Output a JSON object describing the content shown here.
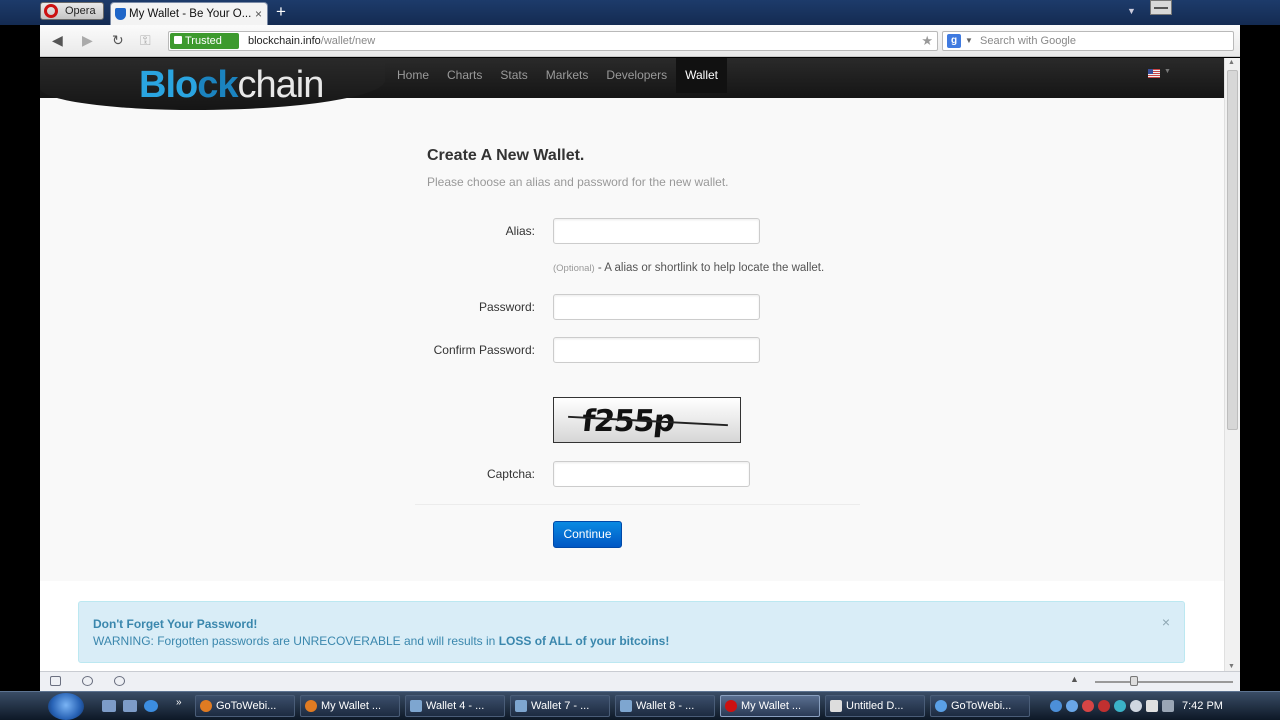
{
  "browser": {
    "opera_label": "Opera",
    "tab_title": "My Wallet - Be Your O...",
    "trusted_label": "Trusted",
    "url_host": "blockchain.info",
    "url_path": "/wallet/new",
    "search_placeholder": "Search with Google"
  },
  "site": {
    "logo_b": "Blo",
    "logo_c": "ck",
    "logo_rest": "chain",
    "nav": [
      "Home",
      "Charts",
      "Stats",
      "Markets",
      "Developers",
      "Wallet"
    ],
    "active_nav": "Wallet"
  },
  "form": {
    "title": "Create A New Wallet.",
    "subtitle": "Please choose an alias and password for the new wallet.",
    "alias_label": "Alias:",
    "alias_value": "",
    "alias_help_optional": "(Optional)",
    "alias_help_text": " - A alias or shortlink to help locate the wallet.",
    "password_label": "Password:",
    "password_value": "",
    "confirm_label": "Confirm Password:",
    "confirm_value": "",
    "captcha_text": "f255p",
    "captcha_label": "Captcha:",
    "captcha_value": "",
    "continue_label": "Continue"
  },
  "alert": {
    "title": "Don't Forget Your Password!",
    "body_prefix": "WARNING: Forgotten passwords are UNRECOVERABLE and will results in ",
    "body_strong": "LOSS of ALL of your bitcoins!",
    "close": "×"
  },
  "taskbar": {
    "tasks": [
      "GoToWebi...",
      "My Wallet ...",
      "Wallet 4 - ...",
      "Wallet 7 - ...",
      "Wallet 8 - ...",
      "My Wallet ...",
      "Untitled D...",
      "GoToWebi..."
    ],
    "clock": "7:42 PM"
  },
  "colors": {
    "brand_blue": "#2aa4e0",
    "button_blue": "#0069d6",
    "alert_bg": "#d9edf7",
    "alert_text": "#3a87ad",
    "trusted_green": "#3d9a2e"
  }
}
